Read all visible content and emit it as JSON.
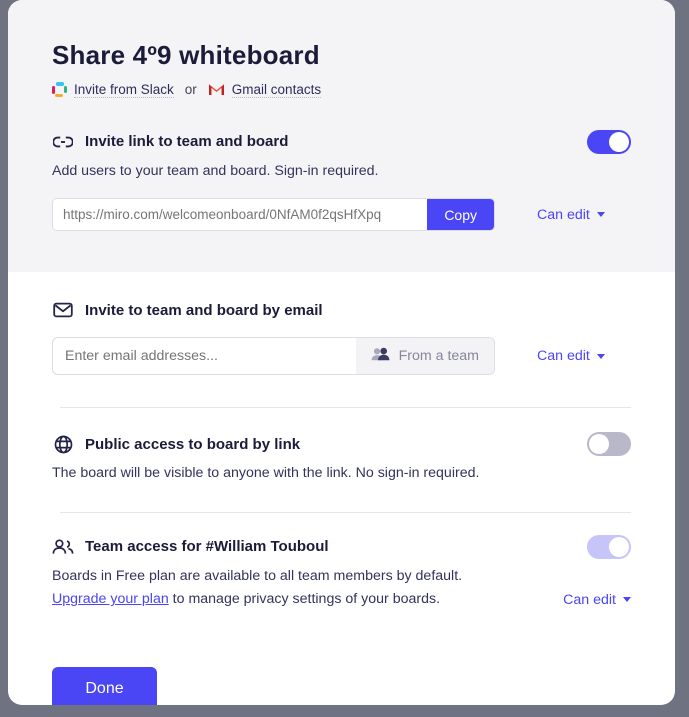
{
  "modal": {
    "title": "Share 4º9 whiteboard",
    "invite_sources": {
      "slack_label": "Invite from Slack",
      "or_label": "or",
      "gmail_label": "Gmail contacts",
      "slack_icon": "slack-icon",
      "gmail_icon": "gmail-icon"
    },
    "sections": {
      "invite_link": {
        "icon": "link-icon",
        "heading": "Invite link to team and board",
        "description": "Add users to your team and board. Sign-in required.",
        "link_value": "https://miro.com/welcomeonboard/0NfAM0f2qsHfXpq",
        "link_placeholder": "https://miro.com/welcomeonboard/0NfAM0f2qsHfXpq",
        "copy_label": "Copy",
        "permission_label": "Can edit",
        "toggle_state": "on"
      },
      "invite_email": {
        "icon": "envelope-icon",
        "heading": "Invite to team and board by email",
        "email_value": "",
        "email_placeholder": "Enter email addresses...",
        "from_team_label": "From a team",
        "from_team_icon": "people-icon",
        "permission_label": "Can edit"
      },
      "public_access": {
        "icon": "globe-icon",
        "heading": "Public access to board by link",
        "description": "The board will be visible to anyone with the link. No sign-in required.",
        "toggle_state": "off"
      },
      "team_access": {
        "icon": "team-icon",
        "heading": "Team access for #William Touboul",
        "description_line1": "Boards in Free plan are available to all team members by default.",
        "upgrade_link": "Upgrade your plan",
        "description_line2": " to manage privacy settings of your boards.",
        "permission_label": "Can edit",
        "toggle_state": "disabled-on"
      }
    },
    "done_label": "Done"
  },
  "colors": {
    "accent": "#4a45f5",
    "heading": "#1b1b3a",
    "body": "#33335c",
    "panel_grey": "#f4f4f6",
    "backdrop": "#6f7280",
    "toggle_off": "#b8b8c8",
    "toggle_disabled": "#c6c4f8"
  }
}
